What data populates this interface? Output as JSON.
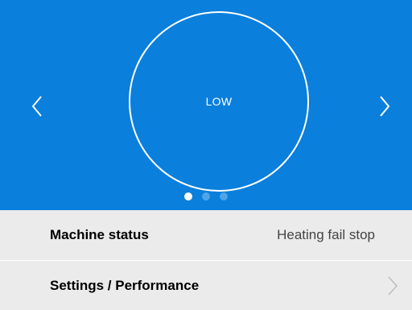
{
  "carousel": {
    "mode_label": "LOW",
    "page_count": 3,
    "active_page": 1,
    "prev_icon": "chevron-left-icon",
    "next_icon": "chevron-right-icon"
  },
  "menu": {
    "status_label": "Machine status",
    "status_value": "Heating fail stop",
    "settings_label": "Settings / Performance",
    "settings_icon": "chevron-right-icon"
  },
  "colors": {
    "accent_blue": "#0a7fdc",
    "panel_background": "#ebebeb",
    "dot_inactive": "#4da5ea",
    "dot_active": "#ffffff"
  }
}
